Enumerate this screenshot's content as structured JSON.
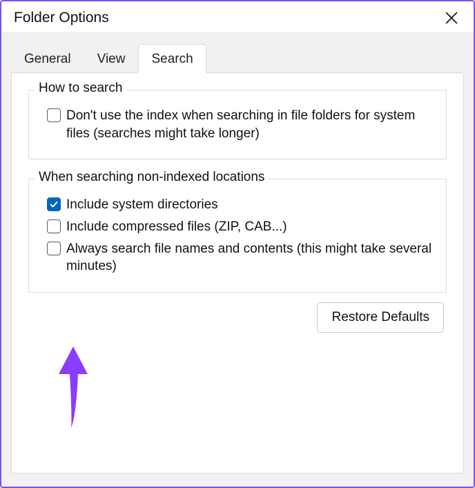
{
  "window": {
    "title": "Folder Options"
  },
  "tabs": {
    "general": "General",
    "view": "View",
    "search": "Search"
  },
  "groups": {
    "how": {
      "legend": "How to search",
      "opt_noindex": {
        "label": "Don't use the index when searching in file folders for system files (searches might take longer)",
        "checked": false
      }
    },
    "nonindexed": {
      "legend": "When searching non-indexed locations",
      "opt_sysdirs": {
        "label": "Include system directories",
        "checked": true
      },
      "opt_compressed": {
        "label": "Include compressed files (ZIP, CAB...)",
        "checked": false
      },
      "opt_contents": {
        "label": "Always search file names and contents (this might take several minutes)",
        "checked": false
      }
    }
  },
  "buttons": {
    "restore": "Restore Defaults"
  }
}
